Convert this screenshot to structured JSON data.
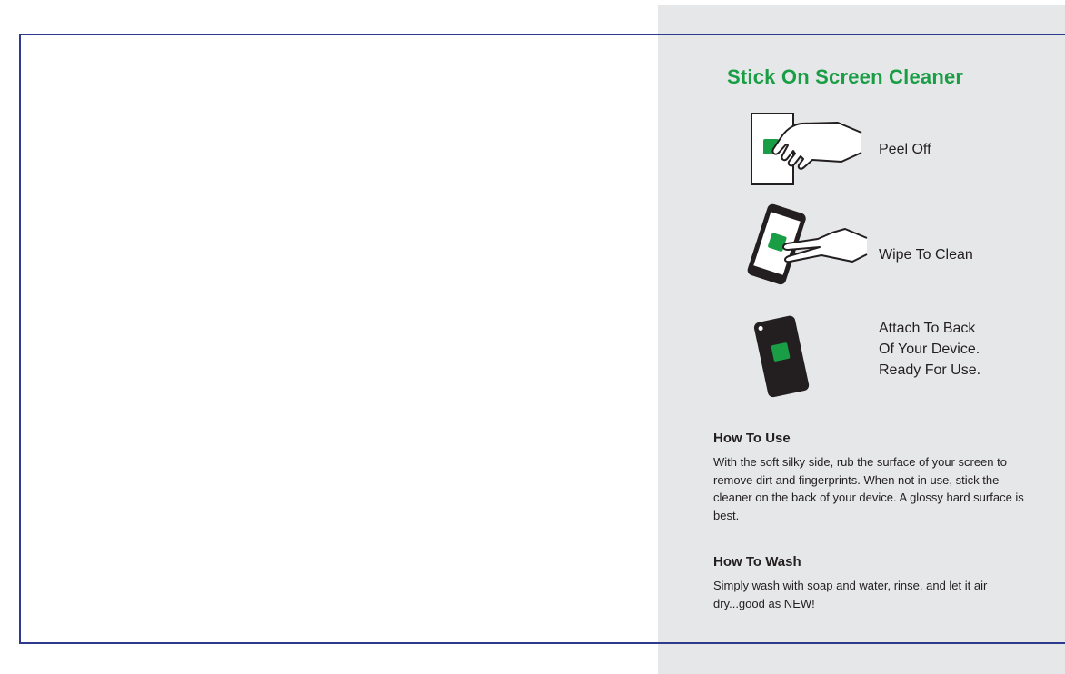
{
  "panel": {
    "title": "Stick On Screen Cleaner",
    "steps": [
      {
        "icon": "peel-off-icon",
        "label": "Peel Off"
      },
      {
        "icon": "wipe-phone-icon",
        "label": "Wipe To Clean"
      },
      {
        "icon": "phone-back-icon",
        "lines": [
          "Attach To Back",
          "Of Your Device.",
          "Ready For Use."
        ]
      }
    ],
    "how_to_use": {
      "heading": "How To Use",
      "body": "With the soft silky side, rub the surface of your screen to remove dirt and fingerprints. When not in use, stick the cleaner on the back of your device. A glossy hard surface is best."
    },
    "how_to_wash": {
      "heading": "How To Wash",
      "body": "Simply wash with soap and water, rinse, and let it air dry...good as NEW!"
    }
  },
  "colors": {
    "accent_green": "#1a9e45",
    "frame_blue": "#2e3a8c",
    "panel_gray": "#e6e7e8"
  }
}
